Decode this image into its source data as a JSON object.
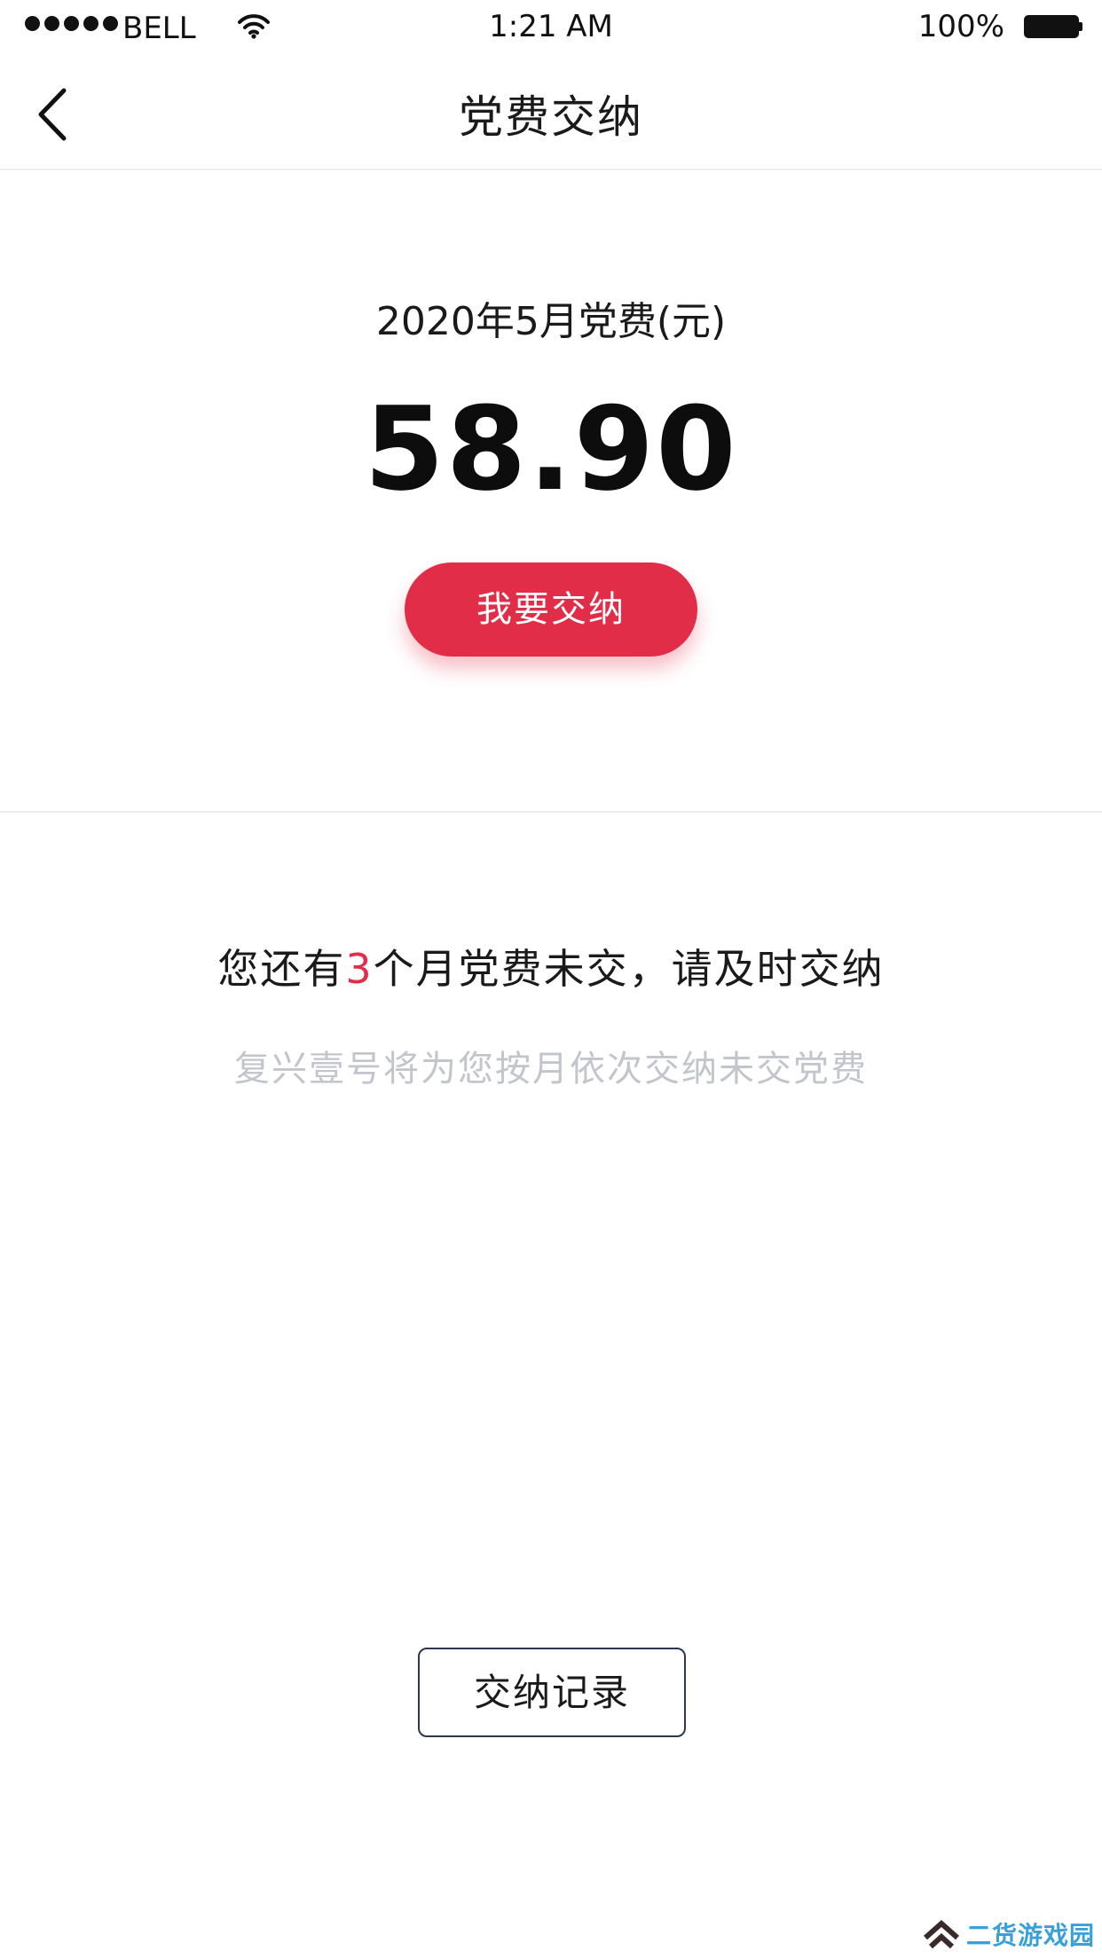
{
  "status_bar": {
    "carrier": "BELL",
    "time": "1:21 AM",
    "battery": "100%",
    "battery_level": 1.0
  },
  "nav": {
    "title": "党费交纳",
    "back_icon": "chevron-left-icon"
  },
  "fee": {
    "label": "2020年5月党费(元)",
    "amount": "58.90",
    "pay_button_label": "我要交纳"
  },
  "notice": {
    "prefix": "您还有",
    "unpaid_months": "3",
    "suffix": "个月党费未交，请及时交纳",
    "sub_text": "复兴壹号将为您按月依次交纳未交党费"
  },
  "records": {
    "button_label": "交纳记录"
  },
  "watermark": {
    "text": "二货游戏园"
  },
  "colors": {
    "accent": "#e12d48",
    "muted_text": "#c2c6cc",
    "outline": "#2c3850"
  }
}
